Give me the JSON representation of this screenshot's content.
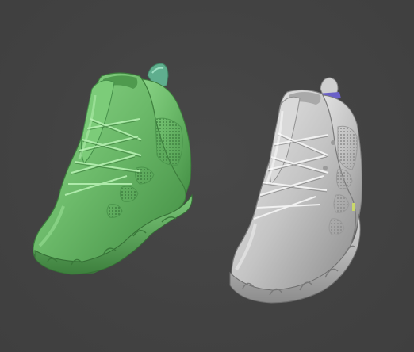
{
  "viewport": {
    "background_color": "#424242",
    "objects": [
      {
        "name": "green-sneaker-model",
        "color": "#6cba6a",
        "state": "selected"
      },
      {
        "name": "gray-sneaker-model",
        "color": "#c8c8c8",
        "state": "unselected"
      }
    ]
  }
}
